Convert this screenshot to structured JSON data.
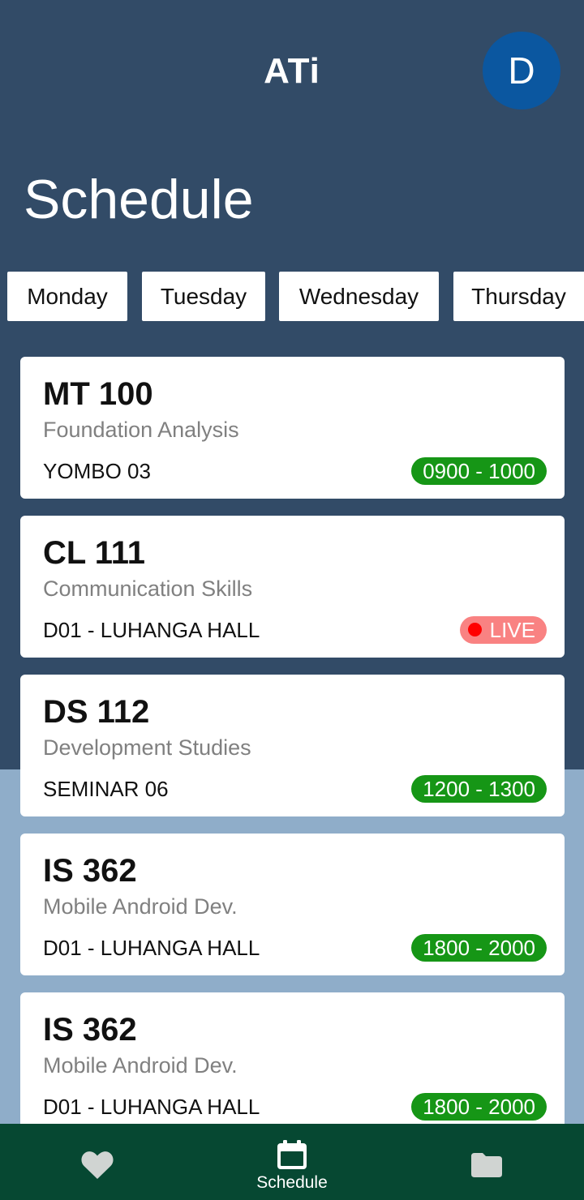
{
  "header": {
    "app_title": "ATi",
    "avatar_initial": "D"
  },
  "page": {
    "title": "Schedule"
  },
  "days": [
    "Monday",
    "Tuesday",
    "Wednesday",
    "Thursday"
  ],
  "courses": [
    {
      "code": "MT 100",
      "name": "Foundation Analysis",
      "venue": "YOMBO 03",
      "time": "0900 - 1000",
      "live": false
    },
    {
      "code": "CL 111",
      "name": "Communication Skills",
      "venue": "D01 - LUHANGA HALL",
      "status": "LIVE",
      "live": true
    },
    {
      "code": "DS 112",
      "name": "Development Studies",
      "venue": "SEMINAR 06",
      "time": "1200 - 1300",
      "live": false
    },
    {
      "code": "IS 362",
      "name": "Mobile Android Dev.",
      "venue": "D01 - LUHANGA HALL",
      "time": "1800 - 2000",
      "live": false
    },
    {
      "code": "IS 362",
      "name": "Mobile Android Dev.",
      "venue": "D01 - LUHANGA HALL",
      "time": "1800 - 2000",
      "live": false
    }
  ],
  "bottom_nav": {
    "items": [
      {
        "icon": "heart-icon",
        "label": ""
      },
      {
        "icon": "calendar-icon",
        "label": "Schedule"
      },
      {
        "icon": "folder-icon",
        "label": ""
      }
    ]
  },
  "colors": {
    "header_bg": "#324b67",
    "lower_bg": "#8fadc9",
    "avatar": "#0b57a0",
    "time_badge": "#169616",
    "live_badge": "#f98282",
    "live_dot": "#ff0000",
    "bottom_nav": "#064832"
  }
}
